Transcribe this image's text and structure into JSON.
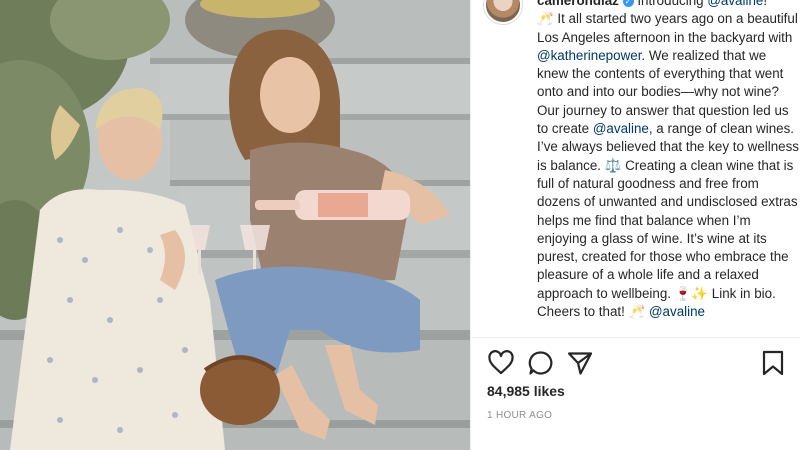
{
  "post": {
    "photo_alt": "",
    "author": {
      "username": "camerondiaz",
      "verified_symbol": "✓"
    },
    "caption": {
      "intro_text": " Introducing ",
      "mention_1": "@avaline",
      "after_mention_1": "!",
      "line_2": "🥂 It all started two years ago on a beautiful Los Angeles afternoon in the backyard with ",
      "mention_2": "@katherinepower",
      "line_3": ". We realized that we knew the contents of everything that went onto and into our bodies—why not wine? Our journey to answer that question led us to create ",
      "mention_3": "@avaline",
      "line_4": ", a range of clean wines. I’ve always believed that the key to wellness is balance. ⚖️ Creating a clean wine that is full of natural goodness and free from dozens of unwanted and undisclosed extras helps me find that balance when I’m enjoying a glass of wine. It’s wine at its purest, created for those who embrace the pleasure of a whole life and a relaxed approach to wellbeing. 🍷✨ Link in bio. Cheers to that! 🥂 ",
      "mention_4": "@avaline"
    },
    "actions": {
      "like_icon": "heart-icon",
      "comment_icon": "comment-icon",
      "share_icon": "share-icon",
      "save_icon": "bookmark-icon"
    },
    "likes_text": "84,985 likes",
    "timestamp": "1 HOUR AGO"
  },
  "colors": {
    "text": "#262626",
    "mention": "#00376b",
    "muted": "#8e8e8e",
    "verified": "#3897f0",
    "divider": "#efefef"
  }
}
